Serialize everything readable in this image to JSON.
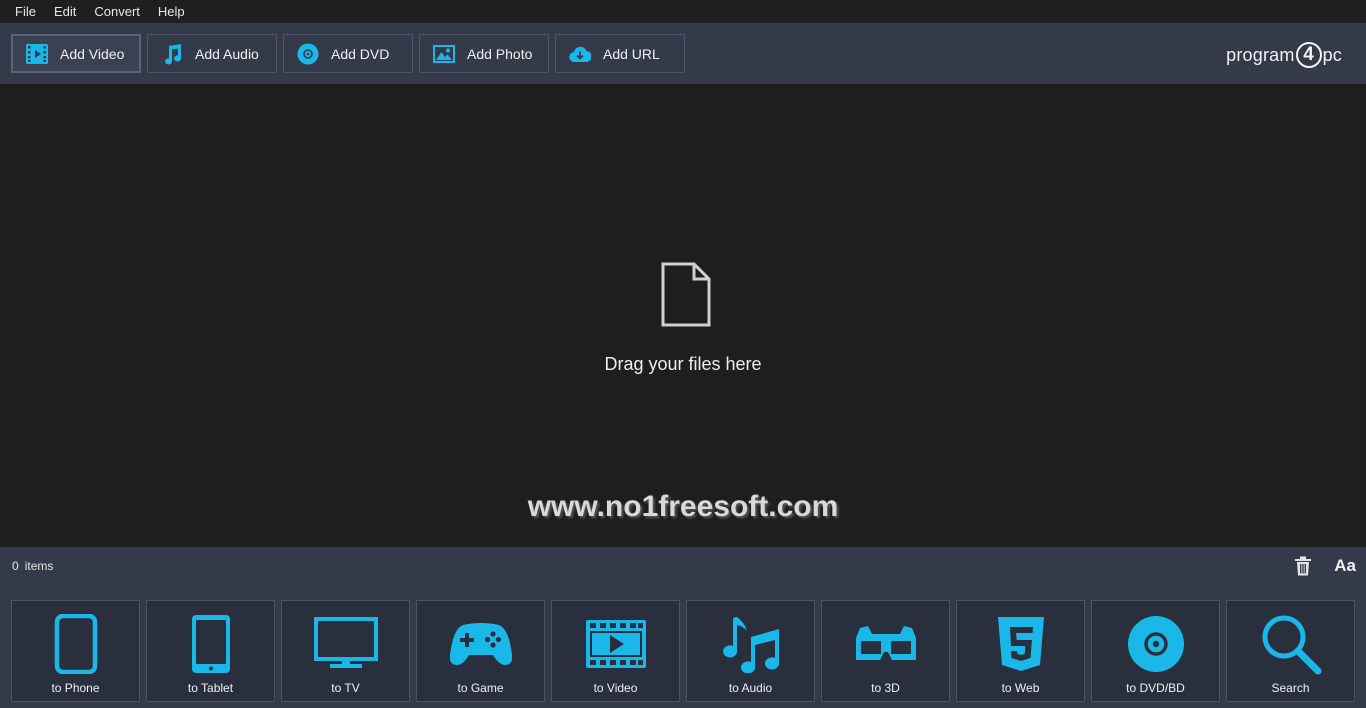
{
  "menu": [
    "File",
    "Edit",
    "Convert",
    "Help"
  ],
  "toolbar": {
    "buttons": [
      {
        "label": "Add Video",
        "icon": "film-icon"
      },
      {
        "label": "Add Audio",
        "icon": "music-note-icon"
      },
      {
        "label": "Add DVD",
        "icon": "disc-icon"
      },
      {
        "label": "Add Photo",
        "icon": "image-icon"
      },
      {
        "label": "Add URL",
        "icon": "cloud-download-icon"
      }
    ],
    "logo_pre": "program",
    "logo_num": "4",
    "logo_post": "pc"
  },
  "dropzone": {
    "text": "Drag your files here",
    "watermark": "www.no1freesoft.com"
  },
  "status": {
    "count": "0",
    "items_label": "items",
    "font_button": "Aa"
  },
  "presets": [
    {
      "label": "to Phone",
      "icon": "phone-icon"
    },
    {
      "label": "to Tablet",
      "icon": "tablet-icon"
    },
    {
      "label": "to TV",
      "icon": "tv-icon"
    },
    {
      "label": "to Game",
      "icon": "gamepad-icon"
    },
    {
      "label": "to Video",
      "icon": "film-play-icon"
    },
    {
      "label": "to Audio",
      "icon": "music-notes-icon"
    },
    {
      "label": "to 3D",
      "icon": "3d-glasses-icon"
    },
    {
      "label": "to Web",
      "icon": "html5-icon"
    },
    {
      "label": "to DVD/BD",
      "icon": "disc-icon"
    },
    {
      "label": "Search",
      "icon": "search-icon"
    }
  ],
  "colors": {
    "accent": "#1ab8e8",
    "toolbar_bg": "#343a4a",
    "workspace_bg": "#1e1e1e",
    "tile_bg": "#2a2f3d"
  }
}
